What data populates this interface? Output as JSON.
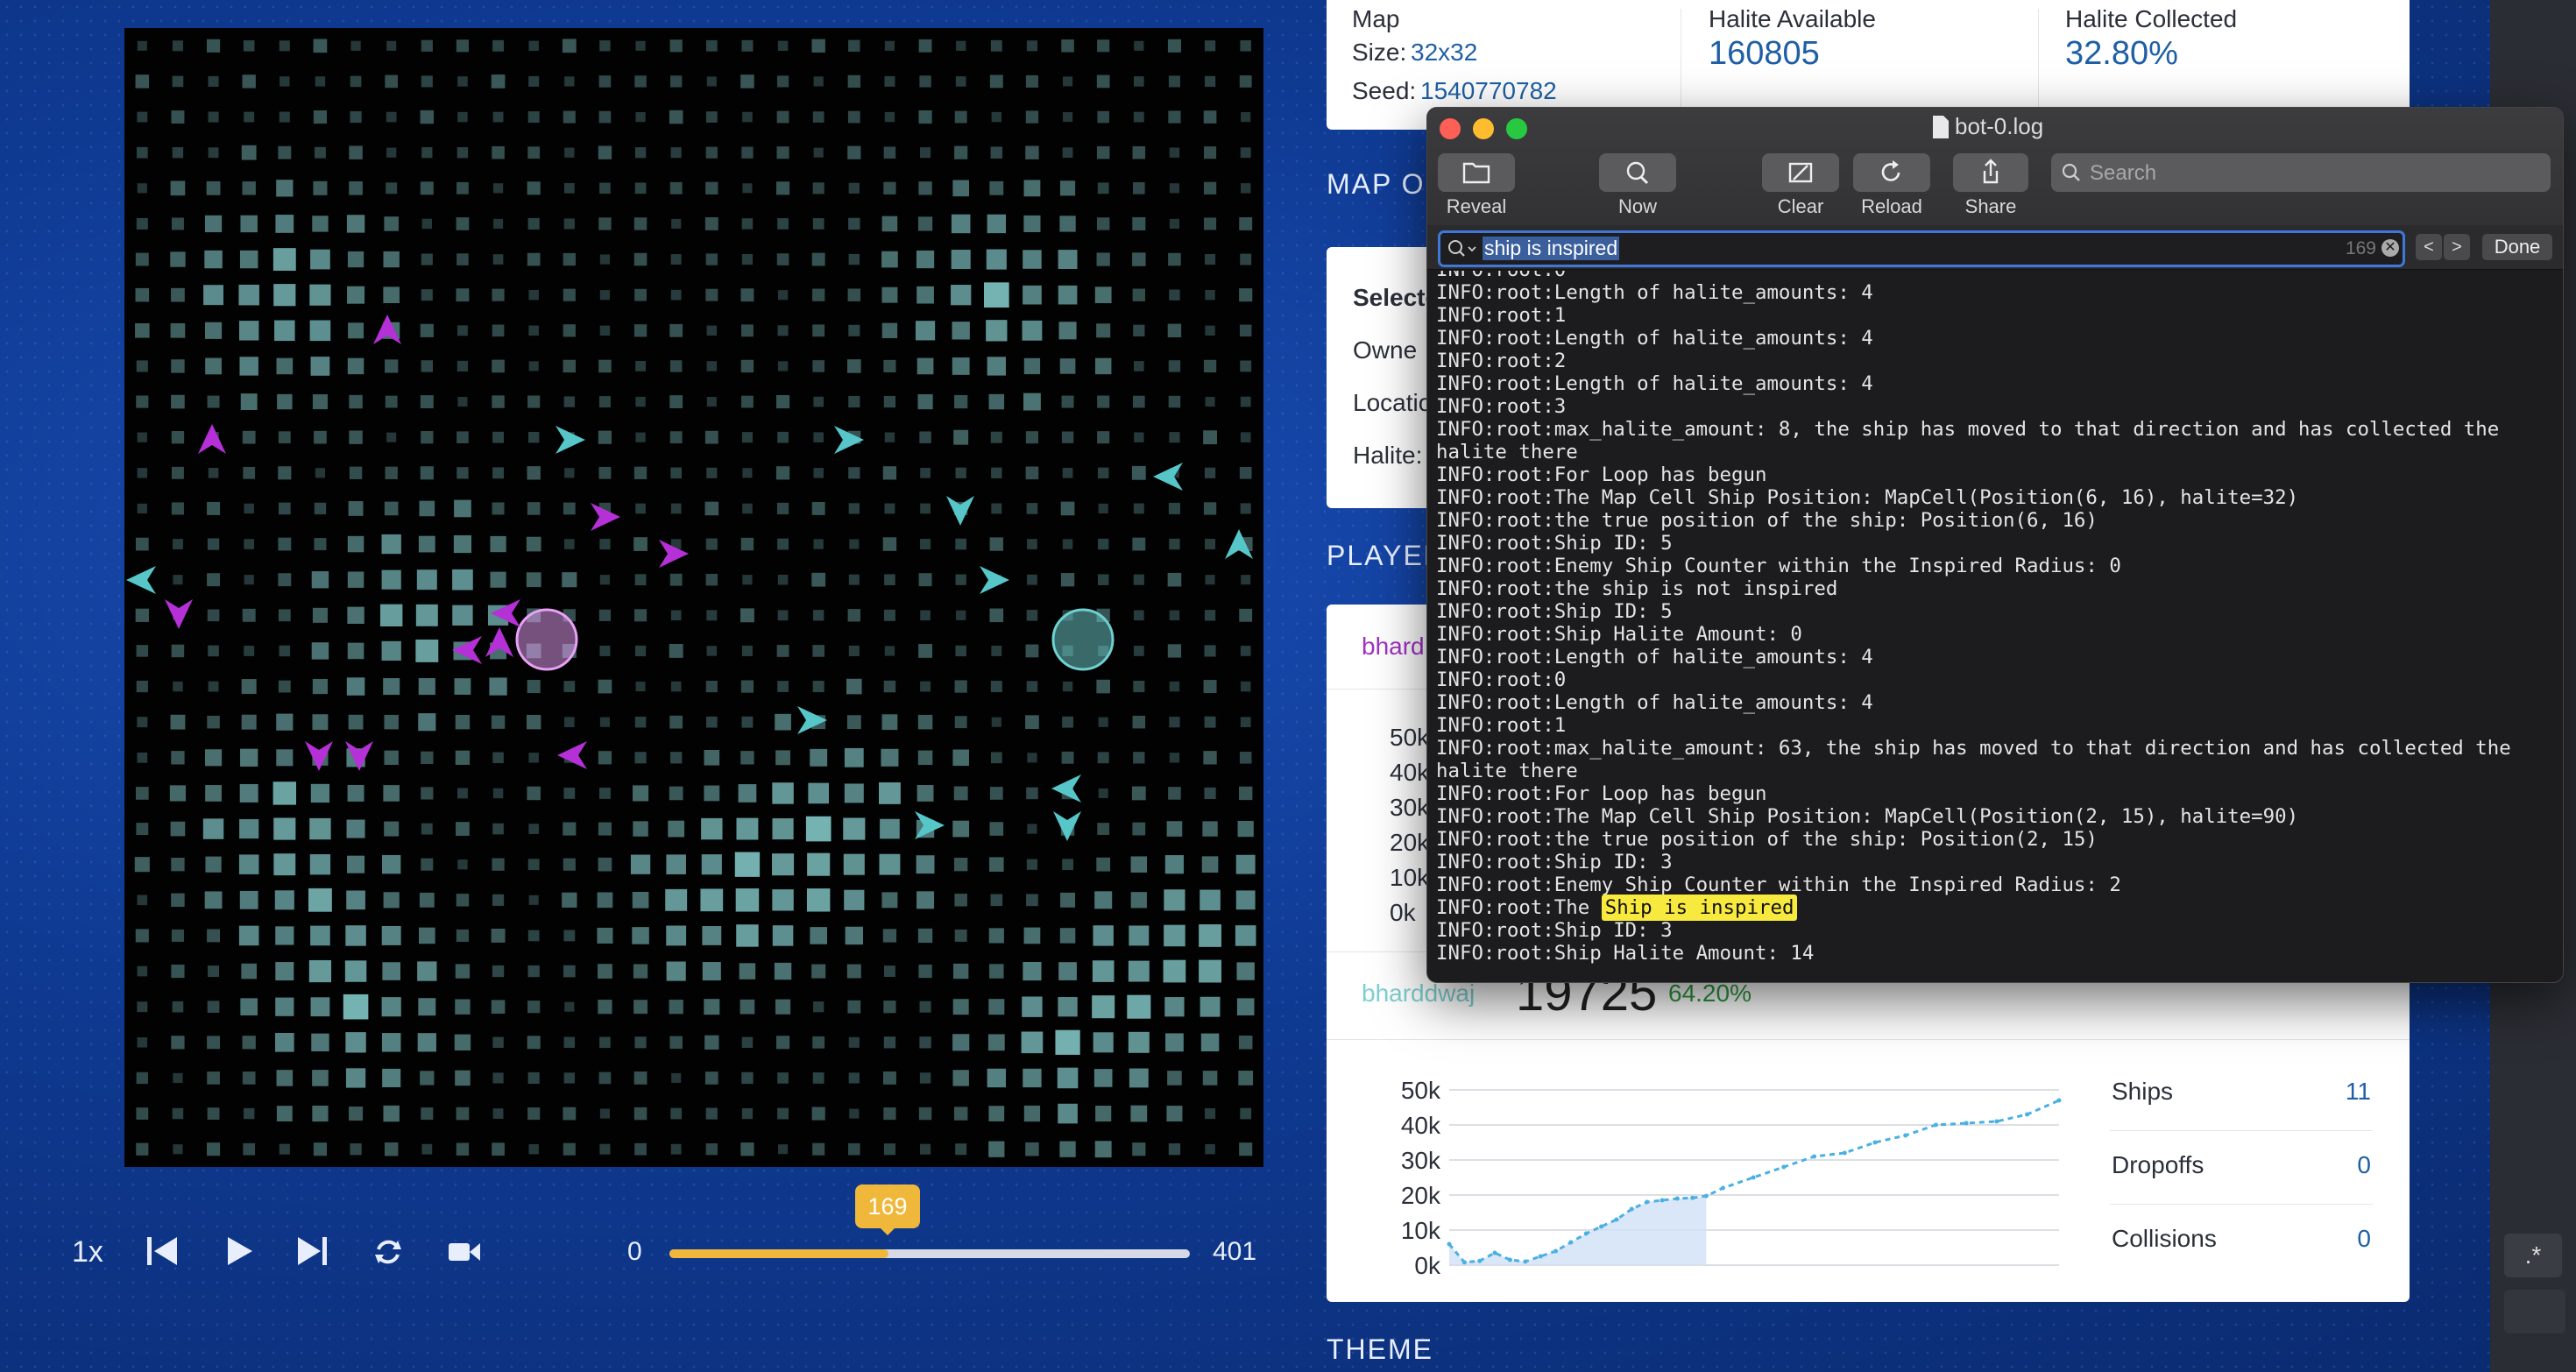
{
  "game": {
    "turn": "169",
    "turn_min": "0",
    "turn_max": "401",
    "progress": 0.421,
    "speed": "1x",
    "colors": {
      "player_magenta": "#b530d6",
      "player_teal": "#56c6c8",
      "halite": "#8fd9d9"
    }
  },
  "summary": {
    "map_label": "Map",
    "size_label": "Size:",
    "size_value": "32x32",
    "seed_label": "Seed:",
    "seed_value": "1540770782",
    "halite_available_label": "Halite Available",
    "halite_available_value": "160805",
    "halite_collected_label": "Halite Collected",
    "halite_collected_value": "32.80%"
  },
  "sections": {
    "map_overview": "MAP O",
    "players": "PLAYER",
    "theme": "THEME"
  },
  "selected": {
    "title": "Selecte",
    "owner": "Owne",
    "location": "Locatio",
    "halite": "Halite:"
  },
  "player1": {
    "name": "bhard",
    "y_ticks": [
      "50k",
      "40k",
      "30k",
      "20k",
      "10k",
      "0k"
    ]
  },
  "player2": {
    "name": "bharddwaj",
    "score": "19725",
    "percent": "64.20%",
    "ships_label": "Ships",
    "ships_value": "11",
    "dropoffs_label": "Dropoffs",
    "dropoffs_value": "0",
    "collisions_label": "Collisions",
    "collisions_value": "0"
  },
  "chart_data": {
    "type": "line",
    "title": "",
    "y_ticks": [
      "50k",
      "40k",
      "30k",
      "20k",
      "10k",
      "0k"
    ],
    "ylim": [
      0,
      50000
    ],
    "x": [
      0,
      10,
      20,
      30,
      40,
      50,
      60,
      70,
      80,
      90,
      100,
      110,
      120,
      130,
      140,
      150,
      160,
      169,
      180,
      200,
      220,
      240,
      260,
      280,
      300,
      320,
      340,
      360,
      380,
      401
    ],
    "values": [
      6000,
      800,
      1200,
      3500,
      1500,
      1000,
      2500,
      4000,
      6500,
      9000,
      11000,
      13000,
      16000,
      18000,
      18500,
      19000,
      19200,
      19725,
      22000,
      25000,
      28000,
      31000,
      32000,
      35000,
      37000,
      40000,
      40500,
      41000,
      43000,
      47000
    ],
    "highlight_until_x": 169
  },
  "log_window": {
    "title": "bot-0.log",
    "buttons": [
      {
        "label": "Reveal",
        "icon": "folder-icon"
      },
      {
        "label": "Now",
        "icon": "zoom-icon"
      },
      {
        "label": "Clear",
        "icon": "clear-icon"
      },
      {
        "label": "Reload",
        "icon": "reload-icon"
      },
      {
        "label": "Share",
        "icon": "share-icon"
      }
    ],
    "search_placeholder": "Search",
    "find_query": "ship is inspired",
    "find_count": "169",
    "done_label": "Done",
    "lines": [
      "INFO:root:Length of halite_amounts: 4",
      "INFO:root:1",
      "INFO:root:Length of halite_amounts: 4",
      "INFO:root:2",
      "INFO:root:Length of halite_amounts: 4",
      "INFO:root:3",
      "INFO:root:max_halite_amount: 8, the ship has moved to that direction and has collected the",
      "halite there",
      "INFO:root:For Loop has begun",
      "INFO:root:The Map Cell Ship Position: MapCell(Position(6, 16), halite=32)",
      "INFO:root:the true position of the ship: Position(6, 16)",
      "INFO:root:Ship ID: 5",
      "INFO:root:Enemy Ship Counter within the Inspired Radius: 0",
      "INFO:root:the ship is not inspired",
      "INFO:root:Ship ID: 5",
      "INFO:root:Ship Halite Amount: 0",
      "INFO:root:Length of halite_amounts: 4",
      "INFO:root:0",
      "INFO:root:Length of halite_amounts: 4",
      "INFO:root:1",
      "INFO:root:max_halite_amount: 63, the ship has moved to that direction and has collected the",
      "halite there",
      "INFO:root:For Loop has begun",
      "INFO:root:The Map Cell Ship Position: MapCell(Position(2, 15), halite=90)",
      "INFO:root:the true position of the ship: Position(2, 15)",
      "INFO:root:Ship ID: 3",
      "INFO:root:Enemy Ship Counter within the Inspired Radius: 2",
      "INFO:root:The Ship is inspired",
      "INFO:root:Ship ID: 3",
      "INFO:root:Ship Halite Amount: 14"
    ],
    "highlight_line_index": 27,
    "highlight_text": "Ship is inspired",
    "partial_top_line": "INFO:root:0"
  },
  "right_edge": {
    "regex_label": ".*"
  }
}
